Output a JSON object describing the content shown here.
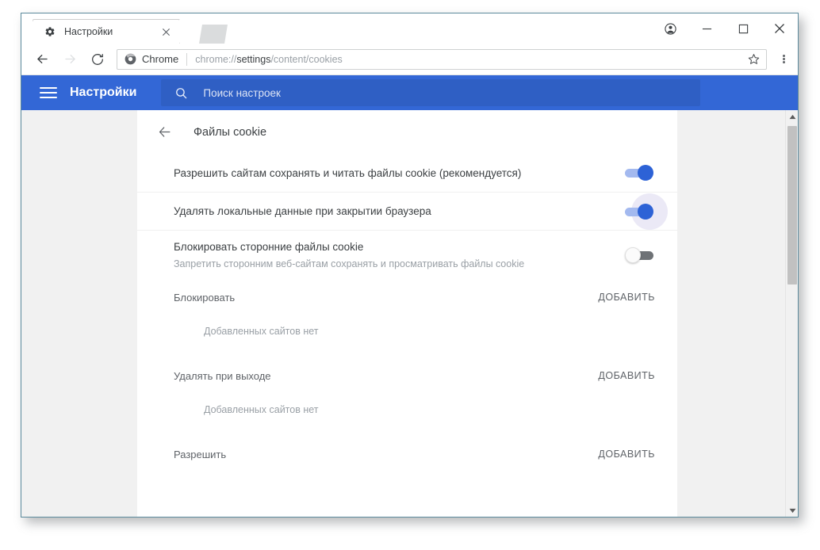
{
  "window": {
    "controls": {
      "profile_label": "profile-avatar",
      "minimize_label": "—",
      "maximize_label": "□",
      "close_label": "✕"
    }
  },
  "tabs": [
    {
      "title": "Настройки",
      "favicon": "gear-icon",
      "close_label": "✕",
      "active": true
    }
  ],
  "toolbar": {
    "back_label": "←",
    "forward_label": "→",
    "reload_label": "⟳",
    "omnibox": {
      "brand_label": "Chrome",
      "url_prefix": "chrome://",
      "url_strong": "settings",
      "url_suffix": "/content/cookies",
      "url_full": "chrome://settings/content/cookies",
      "bookmark_icon": "star-icon"
    },
    "menu_icon": "three-dot-menu-icon"
  },
  "settings_header": {
    "menu_icon": "hamburger-icon",
    "title": "Настройки",
    "search": {
      "icon": "search-icon",
      "placeholder": "Поиск настроек",
      "value": ""
    },
    "background_color": "#3367d6",
    "search_background_color": "#2f5fc4"
  },
  "page": {
    "back_label": "←",
    "title": "Файлы cookie",
    "settings": [
      {
        "label": "Разрешить сайтам сохранять и читать файлы cookie (рекомендуется)",
        "sublabel": "",
        "toggle": "on",
        "focused": false
      },
      {
        "label": "Удалять локальные данные при закрытии браузера",
        "sublabel": "",
        "toggle": "on",
        "focused": true
      },
      {
        "label": "Блокировать сторонние файлы cookie",
        "sublabel": "Запретить сторонним веб-сайтам сохранять и просматривать файлы cookie",
        "toggle": "off",
        "focused": false
      }
    ],
    "exceptions": [
      {
        "title": "Блокировать",
        "add_label": "ДОБАВИТЬ",
        "empty_text": "Добавленных сайтов нет"
      },
      {
        "title": "Удалять при выходе",
        "add_label": "ДОБАВИТЬ",
        "empty_text": "Добавленных сайтов нет"
      },
      {
        "title": "Разрешить",
        "add_label": "ДОБАВИТЬ",
        "empty_text": ""
      }
    ]
  },
  "scrollbar": {
    "up_arrow": "▲",
    "down_arrow": "▼"
  },
  "colors": {
    "accent_blue": "#3367d6",
    "toggle_on": "#2d62d6",
    "toggle_off": "#6e7276",
    "text_primary": "#3c4043",
    "text_secondary": "#9aa0a6"
  }
}
